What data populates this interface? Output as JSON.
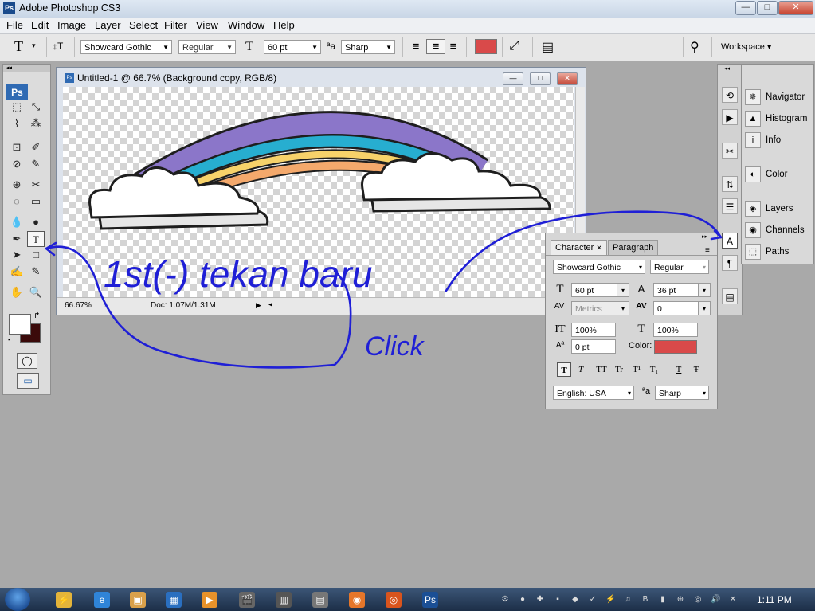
{
  "app": {
    "title": "Adobe Photoshop CS3",
    "logo_text": "Ps",
    "window_buttons": {
      "minimize": "—",
      "maximize": "□",
      "close": "✕"
    }
  },
  "menus": [
    "File",
    "Edit",
    "Image",
    "Layer",
    "Select",
    "Filter",
    "View",
    "Window",
    "Help"
  ],
  "options_bar": {
    "tool_glyph": "T",
    "tool_arrow": "▾",
    "orient_glyph": "↕T",
    "font_family": "Showcard Gothic",
    "font_style": "Regular",
    "size_glyph": "T",
    "font_size": "60 pt",
    "aa_glyph": "ªa",
    "antialias": "Sharp",
    "align_glyphs": [
      "≡",
      "≡",
      "≡"
    ],
    "warp_glyph": "⤢",
    "palette_glyph": "▤",
    "bridge_glyph": "⚲",
    "color": "#d94a4a",
    "workspace_label": "Workspace",
    "workspace_arrow": "▾"
  },
  "toolbox": {
    "grip": "◂◂",
    "badge": "Ps",
    "tools": [
      "⬚",
      "⤡",
      "⌇",
      "⁂",
      "⊡",
      "✐",
      "⊘",
      "✎",
      "⊕",
      "✂",
      "◌",
      "▭",
      "💧",
      "●",
      "✒",
      "T",
      "➤",
      "□",
      "✍",
      "✎",
      "✋",
      "🔍"
    ],
    "fg_color": "#ffffff",
    "bg_color": "#3b0a0a",
    "mask_glyph": "◯",
    "screen_glyph": "▭",
    "swap_glyph": "↱",
    "default_glyph": "▪"
  },
  "document": {
    "title": "Untitled-1 @ 66.7% (Background copy, RGB/8)",
    "ps_glyph": "Ps",
    "buttons": {
      "minimize": "—",
      "maximize": "□",
      "close": "✕"
    },
    "zoom": "66.67%",
    "doc_info": "Doc: 1.07M/1.31M",
    "status_glyphs": {
      "zoom_icon": "◔",
      "next": "▶",
      "prev": "◂"
    }
  },
  "dock": {
    "grip": "◂◂",
    "icons": [
      "⟲",
      "▶",
      "✂",
      "⇅",
      "☰",
      "A",
      "¶",
      "▤"
    ],
    "panels": [
      {
        "label": "Navigator",
        "glyph": "✵"
      },
      {
        "label": "Histogram",
        "glyph": "▲"
      },
      {
        "label": "Info",
        "glyph": "i"
      },
      {
        "label": "Color",
        "glyph": "◐"
      },
      {
        "label": "Layers",
        "glyph": "◈"
      },
      {
        "label": "Channels",
        "glyph": "◉"
      },
      {
        "label": "Paths",
        "glyph": "⬚"
      }
    ]
  },
  "character_panel": {
    "tabs": [
      "Character",
      "Paragraph"
    ],
    "tab_close": "✕",
    "menu_glyph": "▸▸",
    "list_glyph": "≡",
    "arrow": "▾",
    "font_family": "Showcard Gothic",
    "font_style": "Regular",
    "font_size": "60 pt",
    "leading": "36 pt",
    "kerning": "Metrics",
    "tracking": "0",
    "vertical_scale": "100%",
    "horizontal_scale": "100%",
    "baseline_shift": "0 pt",
    "color_label": "Color:",
    "color": "#d94a4a",
    "language": "English: USA",
    "aa_glyph": "ªa",
    "antialias": "Sharp",
    "icon_glyphs": {
      "size": "T",
      "leading": "A",
      "kerning": "AV",
      "tracking": "AV",
      "vscale": "IT",
      "hscale": "T",
      "baseline": "Aª"
    },
    "format_buttons": [
      "T",
      "T",
      "TT",
      "Tr",
      "T¹",
      "T₁",
      "T",
      "Ŧ"
    ]
  },
  "annotations": {
    "scribble": "1st(-) tekan baru",
    "click": "Click",
    "ink_color": "#1f1fd6"
  },
  "taskbar": {
    "clock": "1:11 PM",
    "apps": [
      "⚡",
      "e",
      "▣",
      "▦",
      "▶",
      "🎬",
      "▥",
      "▤",
      "◉",
      "◎",
      "Ps"
    ],
    "tray": [
      "⚙",
      "●",
      "✚",
      "▪",
      "◆",
      "✓",
      "⚡",
      "♫",
      "B",
      "▮",
      "⊕",
      "◎",
      "🔊",
      "✕"
    ]
  }
}
